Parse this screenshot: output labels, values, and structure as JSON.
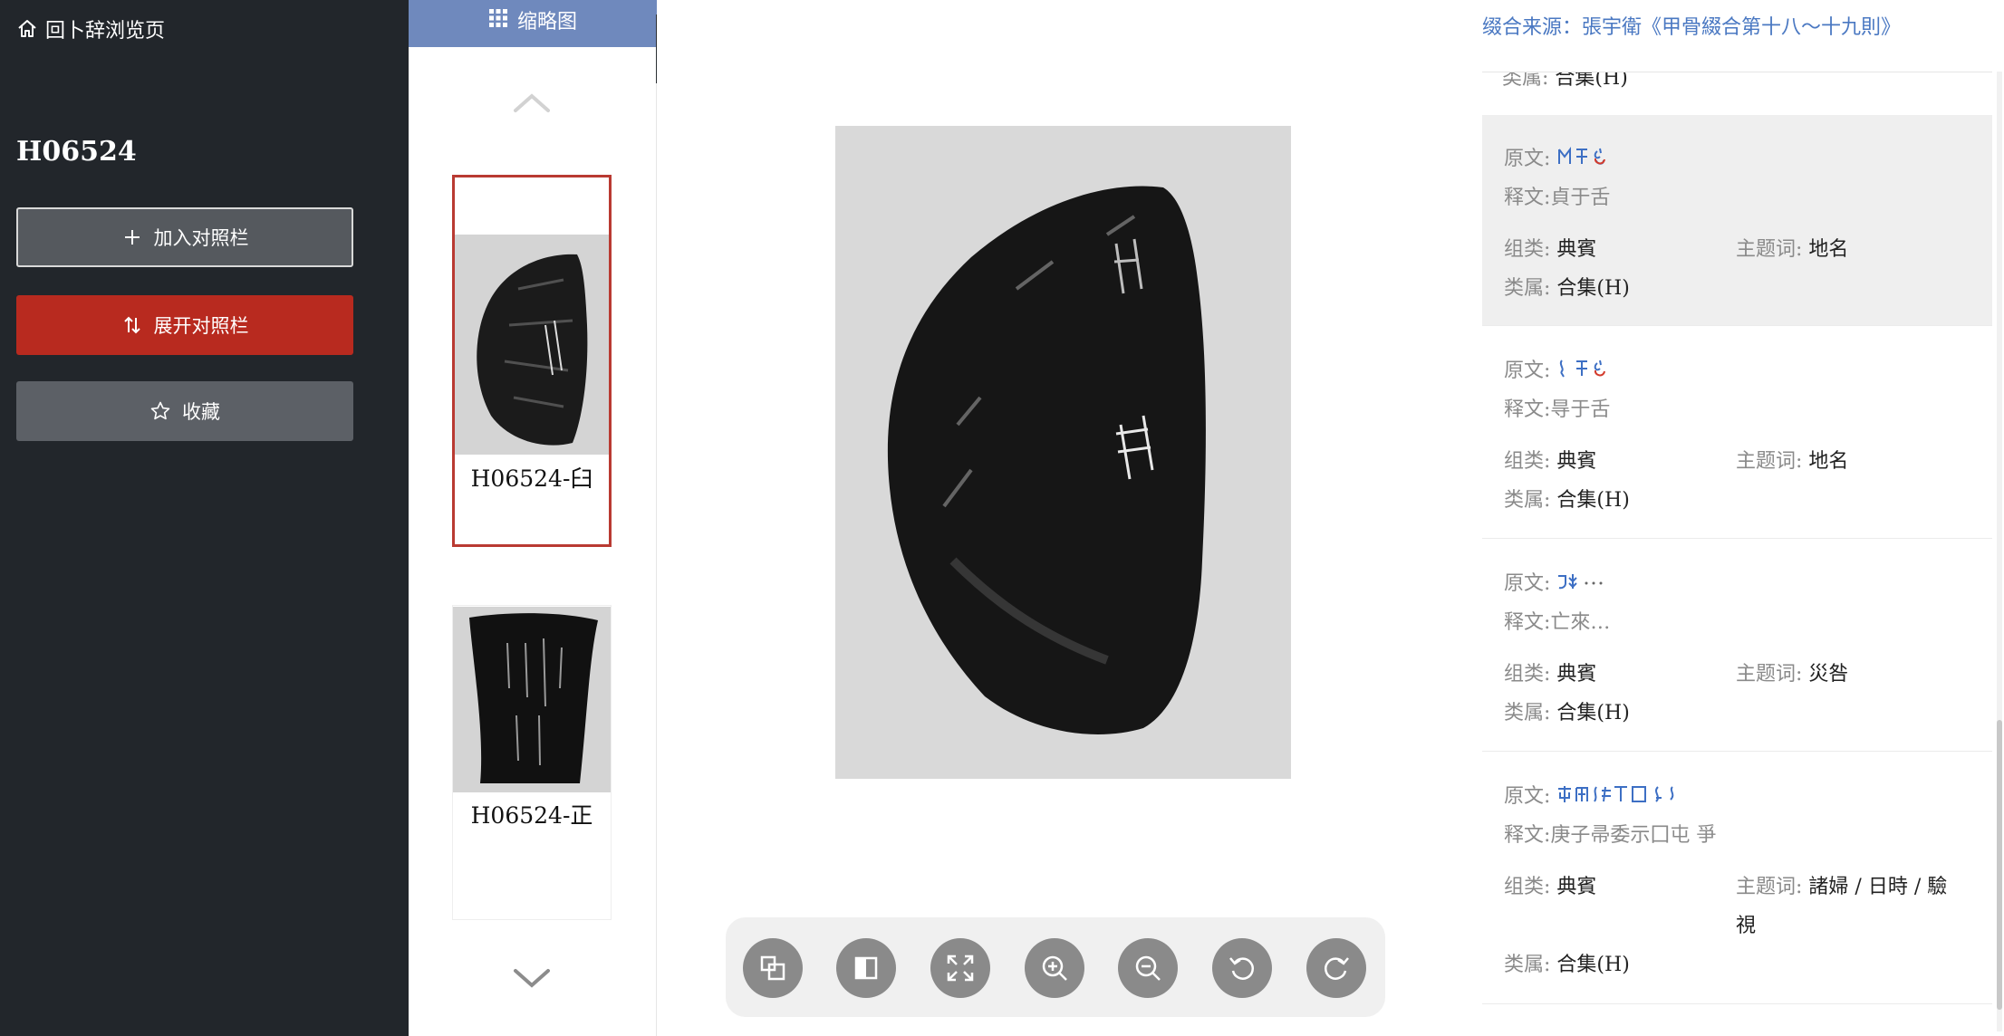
{
  "sidebar": {
    "back_label": "回卜辞浏览页",
    "record_id": "H06524",
    "add_label": "加入对照栏",
    "expand_label": "展开对照栏",
    "favorite_label": "收藏"
  },
  "thumbnails": {
    "header": "缩略图",
    "items": [
      {
        "label": "H06524-臼"
      },
      {
        "label": "H06524-正"
      }
    ],
    "collapse_label": "收起"
  },
  "viewer": {
    "tools": [
      "layout-icon",
      "contrast-icon",
      "fullscreen-icon",
      "zoom-in-icon",
      "zoom-out-icon",
      "rotate-left-icon",
      "rotate-right-icon"
    ]
  },
  "right_panel": {
    "source": "缀合来源：張宇衛《甲骨綴合第十八～十九則》",
    "partial_line": {
      "label": "类属:",
      "value": "合集(H)"
    },
    "labels": {
      "original": "原文:",
      "interp": "释文:",
      "group": "组类:",
      "topic": "主题词:",
      "category": "类属:"
    },
    "entries": [
      {
        "interp": "貞于舌",
        "group": "典賓",
        "topic": "地名",
        "category": "合集(H)"
      },
      {
        "interp": "㝵于舌",
        "group": "典賓",
        "topic": "地名",
        "category": "合集(H)"
      },
      {
        "interp": "亡來…",
        "group": "典賓",
        "topic": "災咎",
        "category": "合集(H)"
      },
      {
        "interp": "庚子帚委示囗屯 爭",
        "group": "典賓",
        "topic_line1": "諸婦 / 日時 / 驗",
        "topic_line2": "視",
        "category": "合集(H)"
      }
    ]
  },
  "colors": {
    "sidebar_bg": "#22262b",
    "accent_red": "#b82a1f",
    "header_blue": "#6f89bd",
    "link_blue": "#4a78c2",
    "glyph_blue": "#3d6fc4",
    "glyph_red": "#d33b2c"
  }
}
